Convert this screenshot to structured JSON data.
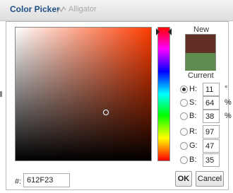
{
  "window": {
    "title": "Color Picker"
  },
  "background_tab": {
    "label": "Alligator",
    "icon": "chart-line-icon"
  },
  "preview": {
    "new_label": "New",
    "current_label": "Current",
    "new_color": "#612F23",
    "current_color": "#5E8C4E"
  },
  "hsb": {
    "h": {
      "label": "H:",
      "value": "11",
      "unit": "°",
      "selected": true
    },
    "s": {
      "label": "S:",
      "value": "64",
      "unit": "%"
    },
    "b": {
      "label": "B:",
      "value": "38",
      "unit": "%"
    }
  },
  "rgb": {
    "r": {
      "label": "R:",
      "value": "97"
    },
    "g": {
      "label": "G:",
      "value": "47"
    },
    "b": {
      "label": "B:",
      "value": "35"
    }
  },
  "hex": {
    "label": "#:",
    "value": "612F23"
  },
  "buttons": {
    "ok": "OK",
    "cancel": "Cancel"
  },
  "colors": {
    "hue_base": "#FF3C00",
    "title": "#1F4F86"
  }
}
